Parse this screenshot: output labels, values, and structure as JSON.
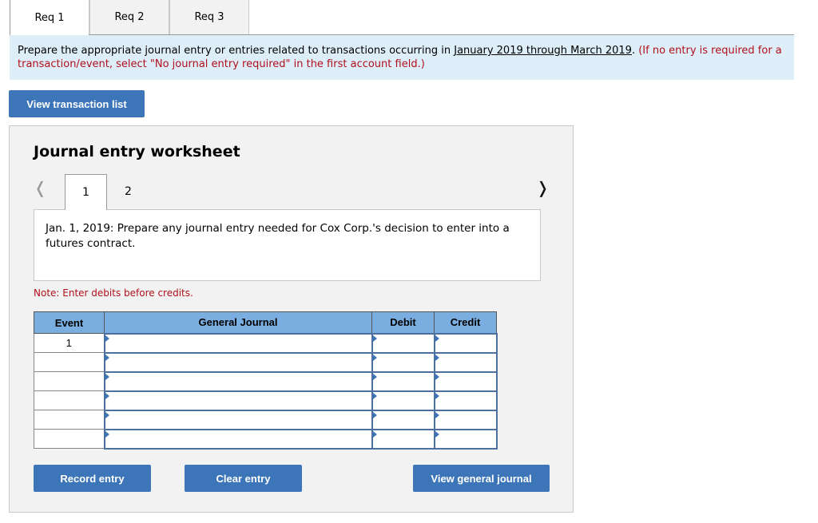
{
  "tabs": [
    {
      "label": "Req 1",
      "active": true
    },
    {
      "label": "Req 2",
      "active": false
    },
    {
      "label": "Req 3",
      "active": false
    }
  ],
  "instructions": {
    "text_before": "Prepare the appropriate journal entry or entries related to transactions occurring in ",
    "underlined": "January 2019 through March 2019",
    "text_after": ". ",
    "red_text": "(If no entry is required for a transaction/event, select \"No journal entry required\" in the first account field.)"
  },
  "view_transaction_list_label": "View transaction list",
  "worksheet": {
    "title": "Journal entry worksheet",
    "prev_icon": "chevron-left-icon",
    "next_icon": "chevron-right-icon",
    "entry_tabs": [
      {
        "label": "1",
        "active": true
      },
      {
        "label": "2",
        "active": false
      }
    ],
    "description": "Jan. 1, 2019: Prepare any journal entry needed for Cox Corp.'s decision to enter into a futures contract.",
    "note": "Note: Enter debits before credits.",
    "table": {
      "headers": [
        "Event",
        "General Journal",
        "Debit",
        "Credit"
      ],
      "rows": [
        {
          "event": "1",
          "account": "",
          "debit": "",
          "credit": ""
        },
        {
          "event": "",
          "account": "",
          "debit": "",
          "credit": ""
        },
        {
          "event": "",
          "account": "",
          "debit": "",
          "credit": ""
        },
        {
          "event": "",
          "account": "",
          "debit": "",
          "credit": ""
        },
        {
          "event": "",
          "account": "",
          "debit": "",
          "credit": ""
        },
        {
          "event": "",
          "account": "",
          "debit": "",
          "credit": ""
        }
      ]
    },
    "buttons": {
      "record": "Record entry",
      "clear": "Clear entry",
      "view_general_journal": "View general journal"
    }
  },
  "colors": {
    "button_blue": "#3d76b8",
    "header_blue": "#7aaee0",
    "banner_bg": "#deeef9",
    "alert_red": "#b0101b"
  }
}
